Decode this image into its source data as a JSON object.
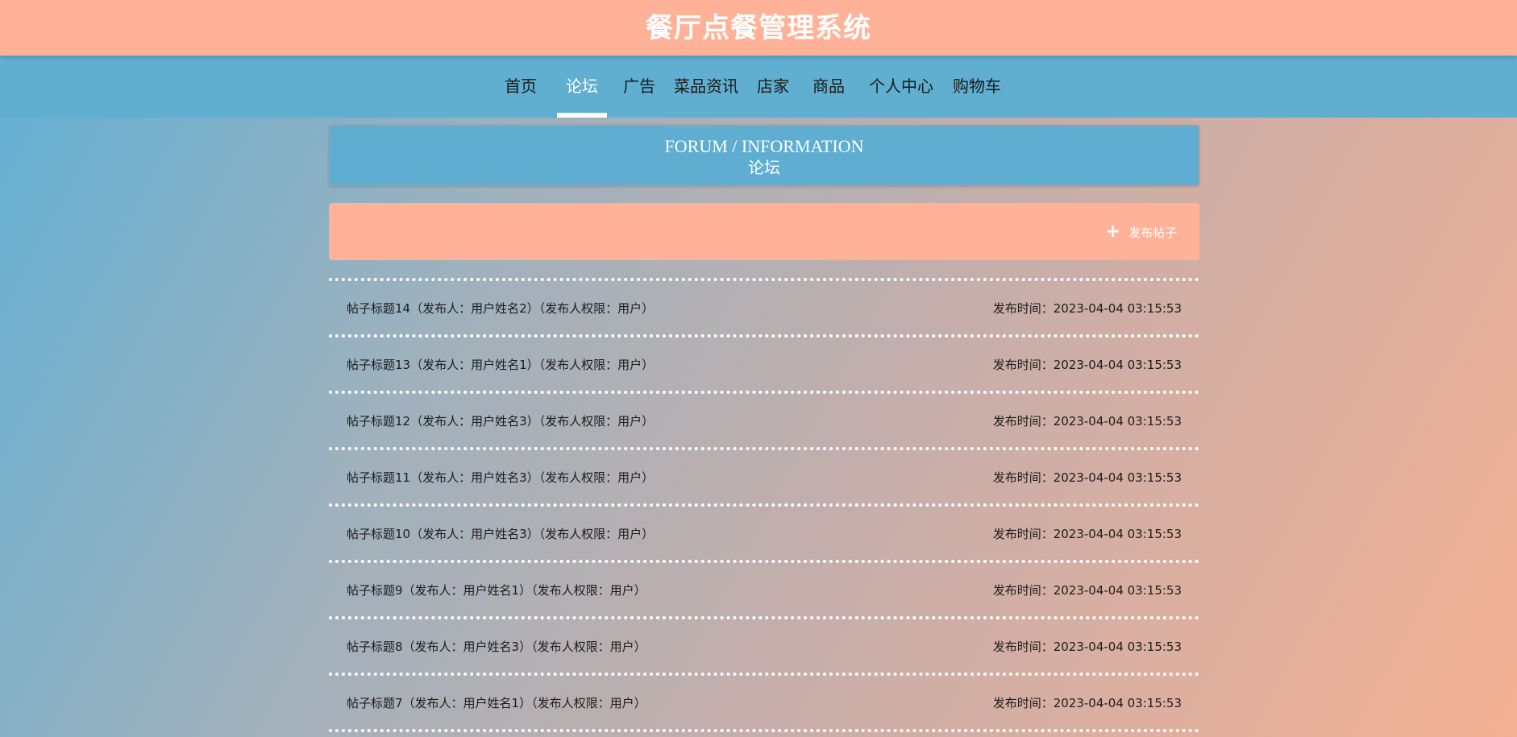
{
  "site": {
    "title": "餐厅点餐管理系统"
  },
  "nav": {
    "items": [
      {
        "label": "首页",
        "active": false
      },
      {
        "label": "论坛",
        "active": true
      },
      {
        "label": "广告",
        "active": false
      },
      {
        "label": "菜品资讯",
        "active": false
      },
      {
        "label": "店家",
        "active": false
      },
      {
        "label": "商品",
        "active": false
      },
      {
        "label": "个人中心",
        "active": false
      },
      {
        "label": "购物车",
        "active": false
      }
    ]
  },
  "section": {
    "title_en": "FORUM / INFORMATION",
    "title_zh": "论坛"
  },
  "actions": {
    "publish_label": "发布帖子",
    "publish_icon": "plus-icon"
  },
  "posts": [
    {
      "title": "帖子标题14（发布人：用户姓名2）（发布人权限：用户）",
      "time": "发布时间：2023-04-04 03:15:53"
    },
    {
      "title": "帖子标题13（发布人：用户姓名1）（发布人权限：用户）",
      "time": "发布时间：2023-04-04 03:15:53"
    },
    {
      "title": "帖子标题12（发布人：用户姓名3）（发布人权限：用户）",
      "time": "发布时间：2023-04-04 03:15:53"
    },
    {
      "title": "帖子标题11（发布人：用户姓名3）（发布人权限：用户）",
      "time": "发布时间：2023-04-04 03:15:53"
    },
    {
      "title": "帖子标题10（发布人：用户姓名3）（发布人权限：用户）",
      "time": "发布时间：2023-04-04 03:15:53"
    },
    {
      "title": "帖子标题9（发布人：用户姓名1）（发布人权限：用户）",
      "time": "发布时间：2023-04-04 03:15:53"
    },
    {
      "title": "帖子标题8（发布人：用户姓名3）（发布人权限：用户）",
      "time": "发布时间：2023-04-04 03:15:53"
    },
    {
      "title": "帖子标题7（发布人：用户姓名1）（发布人权限：用户）",
      "time": "发布时间：2023-04-04 03:15:53"
    }
  ]
}
